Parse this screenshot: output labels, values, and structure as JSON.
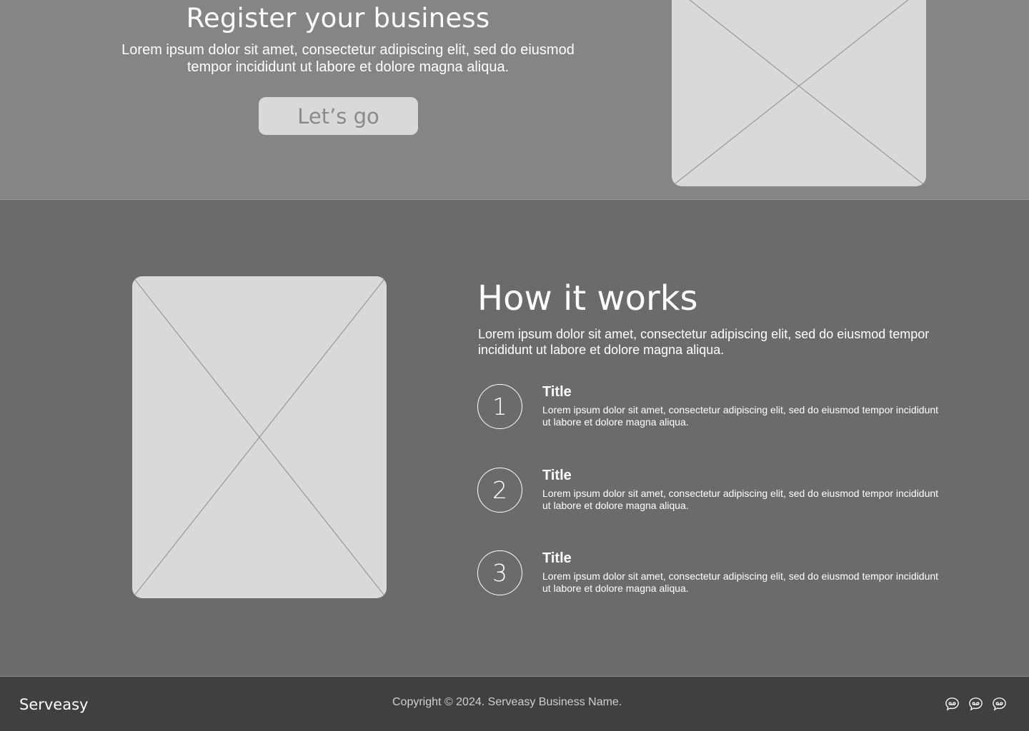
{
  "hero": {
    "title": "Register your business",
    "description": "Lorem ipsum dolor sit amet, consectetur adipiscing elit, sed do eiusmod tempor incididunt ut labore et dolore magna aliqua.",
    "button_label": "Let’s go",
    "image_icon": "image-placeholder-icon"
  },
  "how_it_works": {
    "title": "How it works",
    "description": "Lorem ipsum dolor sit amet, consectetur adipiscing elit, sed do eiusmod tempor incididunt ut labore et dolore magna aliqua.",
    "image_icon": "image-placeholder-icon",
    "steps": [
      {
        "number": "1",
        "title": "Title",
        "text": "Lorem ipsum dolor sit amet, consectetur adipiscing elit, sed do eiusmod tempor incididunt ut labore et dolore magna aliqua."
      },
      {
        "number": "2",
        "title": "Title",
        "text": "Lorem ipsum dolor sit amet, consectetur adipiscing elit, sed do eiusmod tempor incididunt ut labore et dolore magna aliqua."
      },
      {
        "number": "3",
        "title": "Title",
        "text": "Lorem ipsum dolor sit amet, consectetur adipiscing elit, sed do eiusmod tempor incididunt ut labore et dolore magna aliqua."
      }
    ]
  },
  "footer": {
    "brand": "Serveasy",
    "copyright": "Copyright © 2024. Serveasy Business Name.",
    "social_icons": [
      "chat-bubble-icon",
      "chat-bubble-icon",
      "chat-bubble-icon"
    ]
  },
  "colors": {
    "hero_bg": "#858585",
    "main_bg": "#6b6b6b",
    "footer_bg": "#404040",
    "placeholder": "#d9d9d9"
  }
}
